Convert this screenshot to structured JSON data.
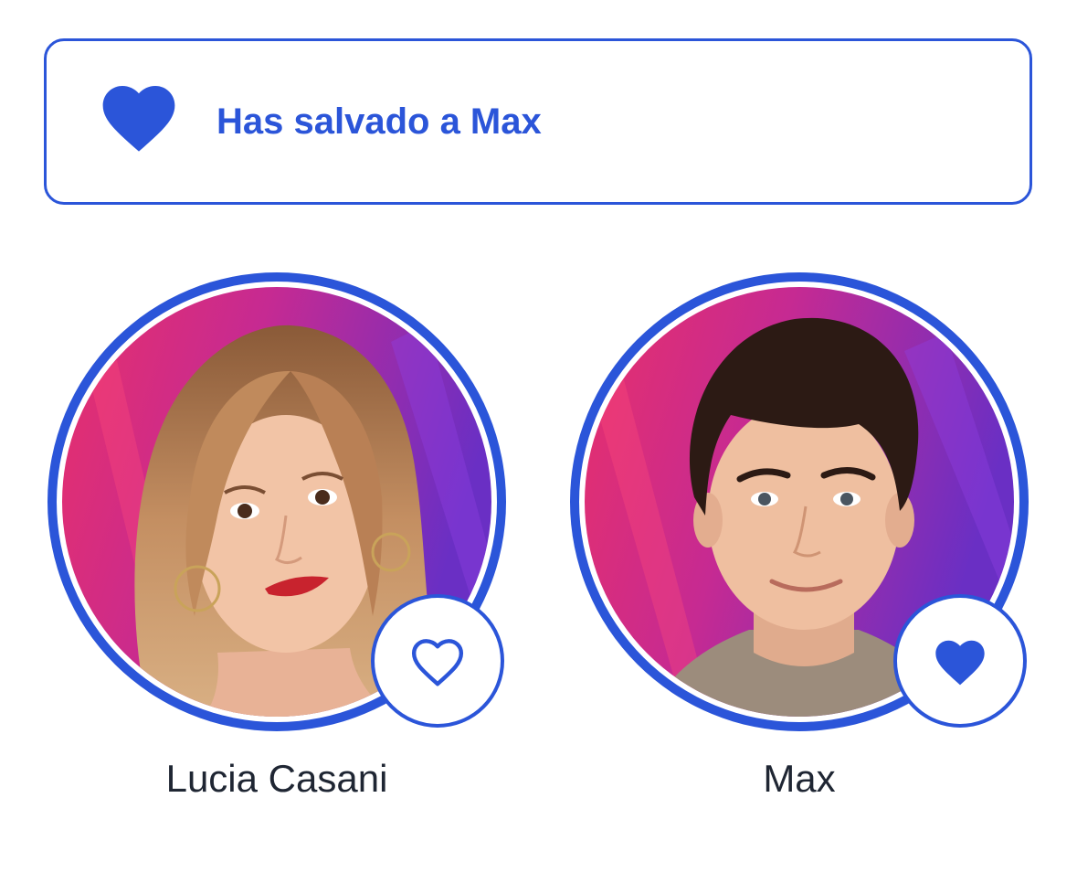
{
  "banner": {
    "text": "Has salvado a Max",
    "icon": "heart-filled-icon"
  },
  "contestants": [
    {
      "name": "Lucia Casani",
      "saved": false,
      "vote_icon": "heart-outline-icon"
    },
    {
      "name": "Max",
      "saved": true,
      "vote_icon": "heart-filled-icon"
    }
  ],
  "colors": {
    "accent": "#2b55d9",
    "name_text": "#1f2633",
    "background": "#ffffff"
  }
}
